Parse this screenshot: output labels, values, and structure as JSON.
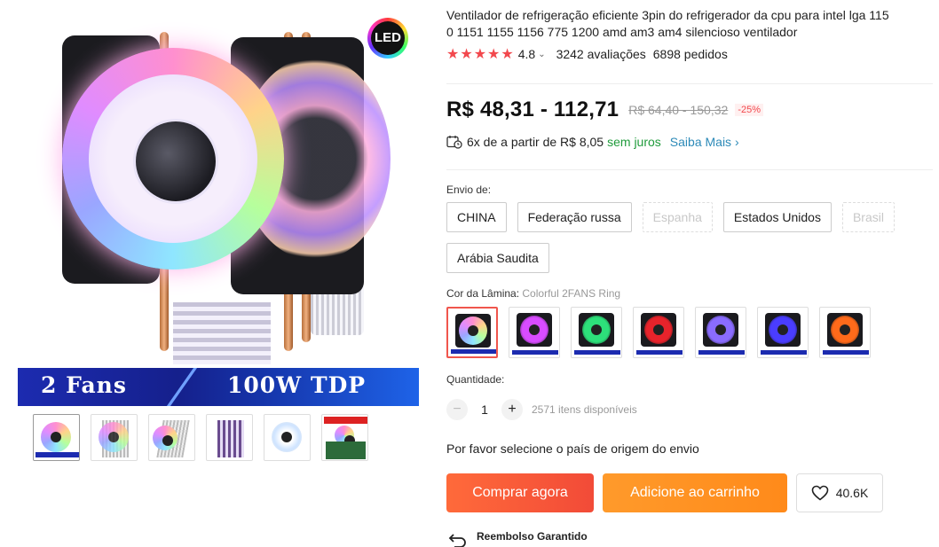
{
  "product": {
    "title": "Ventilador de refrigeração eficiente 3pin do refrigerador da cpu para intel lga 1150 1151 1155 1156 775 1200 amd am3 am4 silencioso ventilador",
    "title_line1": "Ventilador de refrigeração eficiente 3pin do refrigerador da cpu para intel lga 115",
    "title_line2": "0 1151 1155 1156 775 1200 amd am3 am4 silencioso ventilador",
    "stars": "★★★★★",
    "rating": "4.8",
    "reviews": "3242 avaliações",
    "orders": "6898 pedidos"
  },
  "gallery": {
    "led_badge": "LED",
    "banner_left": "2 Fans",
    "banner_right": "100W TDP",
    "thumbs": [
      "thumb-1",
      "thumb-2",
      "thumb-3",
      "thumb-4",
      "thumb-5",
      "thumb-6"
    ]
  },
  "price": {
    "current": "R$ 48,31 - 112,71",
    "original": "R$ 64,40 - 150,32",
    "discount": "-25%"
  },
  "installment": {
    "text": "6x de a partir de R$ 8,05",
    "no_interest": "sem juros",
    "more": "Saiba Mais"
  },
  "shipping": {
    "label": "Envio de:",
    "options": [
      {
        "label": "CHINA",
        "available": true
      },
      {
        "label": "Federação russa",
        "available": true
      },
      {
        "label": "Espanha",
        "available": false
      },
      {
        "label": "Estados Unidos",
        "available": true
      },
      {
        "label": "Brasil",
        "available": false
      },
      {
        "label": "Arábia Saudita",
        "available": true
      }
    ]
  },
  "color": {
    "label": "Cor da Lâmina:",
    "selected": "Colorful 2FANS Ring",
    "swatches": [
      {
        "name": "Colorful 2FANS Ring",
        "fan_color": "#ff9de0"
      },
      {
        "name": "Colorful 2FANS",
        "fan_color": "#d84cff"
      },
      {
        "name": "Green 2FANS",
        "fan_color": "#2de07a"
      },
      {
        "name": "Red 2FANS",
        "fan_color": "#e8232b"
      },
      {
        "name": "Purple 2FANS Ring",
        "fan_color": "#8a6cff"
      },
      {
        "name": "Blue 2FANS",
        "fan_color": "#4a3dff"
      },
      {
        "name": "Orange 2FANS",
        "fan_color": "#ff6a1a"
      }
    ]
  },
  "quantity": {
    "label": "Quantidade:",
    "value": "1",
    "minus": "−",
    "plus": "+",
    "available": "2571 itens disponíveis"
  },
  "ship_note": "Por favor selecione o país de origem do envio",
  "actions": {
    "buy_now": "Comprar agora",
    "add_to_cart": "Adicione ao carrinho",
    "wishlist_count": "40.6K"
  },
  "refund": {
    "title": "Reembolso Garantido"
  },
  "colors": {
    "accent": "#f2484d",
    "buy_button": "#f24b38",
    "cart_button": "#ff8a1a",
    "green": "#1f9b3b",
    "link": "#2d8ab8"
  }
}
